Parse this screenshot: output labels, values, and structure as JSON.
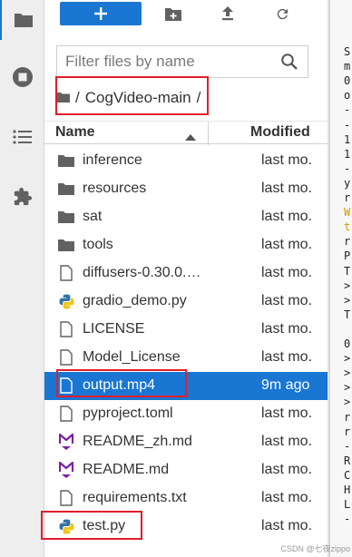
{
  "activity_bar": {
    "items": [
      {
        "icon": "folder-icon",
        "active": true
      },
      {
        "icon": "stop-circle-icon",
        "active": false
      },
      {
        "icon": "list-icon",
        "active": false
      },
      {
        "icon": "puzzle-icon",
        "active": false
      }
    ]
  },
  "toolbar": {
    "new_label": "+",
    "buttons": [
      "new-folder-icon",
      "upload-icon",
      "refresh-icon"
    ]
  },
  "filter": {
    "placeholder": "Filter files by name",
    "value": ""
  },
  "breadcrumb": {
    "separator": "/",
    "path": "CogVideo-main",
    "trailing": "/"
  },
  "list_header": {
    "name": "Name",
    "modified": "Modified"
  },
  "files": [
    {
      "name": "inference",
      "modified": "last mo.",
      "type": "folder"
    },
    {
      "name": "resources",
      "modified": "last mo.",
      "type": "folder"
    },
    {
      "name": "sat",
      "modified": "last mo.",
      "type": "folder"
    },
    {
      "name": "tools",
      "modified": "last mo.",
      "type": "folder"
    },
    {
      "name": "diffusers-0.30.0.d...",
      "modified": "last mo.",
      "type": "file"
    },
    {
      "name": "gradio_demo.py",
      "modified": "last mo.",
      "type": "python"
    },
    {
      "name": "LICENSE",
      "modified": "last mo.",
      "type": "file"
    },
    {
      "name": "Model_License",
      "modified": "last mo.",
      "type": "file"
    },
    {
      "name": "output.mp4",
      "modified": "9m ago",
      "type": "file",
      "selected": true
    },
    {
      "name": "pyproject.toml",
      "modified": "last mo.",
      "type": "file"
    },
    {
      "name": "README_zh.md",
      "modified": "last mo.",
      "type": "markdown"
    },
    {
      "name": "README.md",
      "modified": "last mo.",
      "type": "markdown"
    },
    {
      "name": "requirements.txt",
      "modified": "last mo.",
      "type": "file"
    },
    {
      "name": "test.py",
      "modified": "last mo.",
      "type": "python"
    }
  ],
  "terminal": {
    "lines": [
      "S",
      "m",
      "0",
      "o",
      "-",
      "-",
      "1",
      "1",
      "-",
      "y",
      "r",
      "W",
      "t",
      "r",
      "P",
      "T",
      ">",
      ">",
      "T",
      "",
      "0",
      ">",
      ">",
      ">",
      ">",
      "r",
      "r",
      "-",
      "R",
      "C",
      "H",
      "L",
      "-"
    ],
    "warn_lines": [
      11,
      12
    ]
  },
  "watermark": "CSDN @七夜zippo",
  "colors": {
    "accent": "#1976d2",
    "highlight_box": "#e01e2b",
    "folder": "#616161",
    "markdown": "#7b1fa2"
  }
}
